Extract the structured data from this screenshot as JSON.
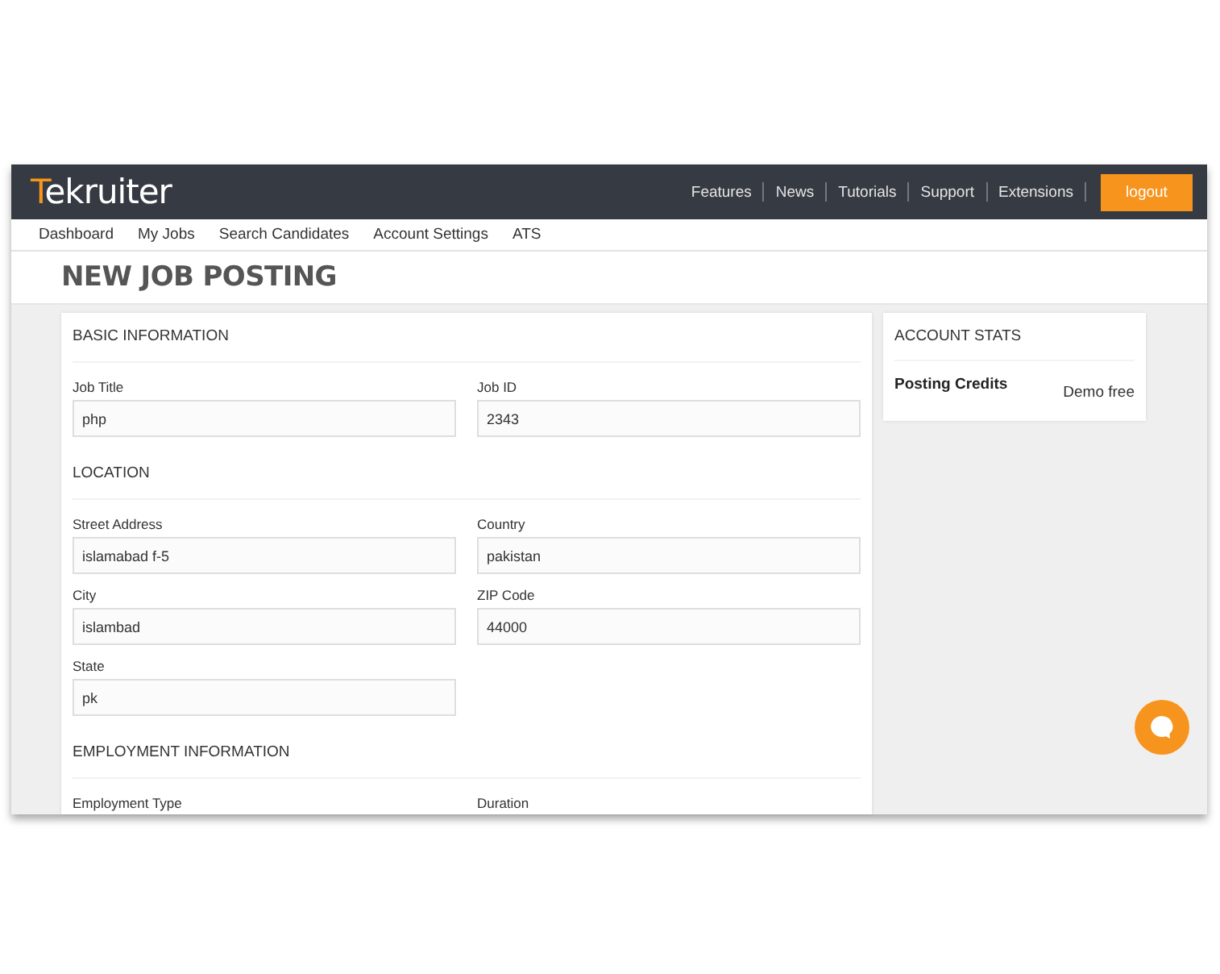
{
  "header": {
    "logo": {
      "mark": "T",
      "rest": "ekruiter"
    },
    "links": [
      "Features",
      "News",
      "Tutorials",
      "Support",
      "Extensions"
    ],
    "logout_button": "logout"
  },
  "nav": [
    "Dashboard",
    "My Jobs",
    "Search Candidates",
    "Account Settings",
    "ATS"
  ],
  "page_title": "NEW JOB POSTING",
  "form": {
    "sections": [
      {
        "heading": "BASIC INFORMATION",
        "fields": [
          {
            "label": "Job Title",
            "value": "php"
          },
          {
            "label": "Job ID",
            "value": "2343"
          }
        ]
      },
      {
        "heading": "LOCATION",
        "fields": [
          {
            "label": "Street Address",
            "value": "islamabad f-5"
          },
          {
            "label": "Country",
            "value": "pakistan"
          },
          {
            "label": "City",
            "value": "islambad"
          },
          {
            "label": "ZIP Code",
            "value": "44000"
          },
          {
            "label": "State",
            "value": "pk"
          }
        ]
      },
      {
        "heading": "EMPLOYMENT INFORMATION",
        "fields": [
          {
            "label": "Employment Type"
          },
          {
            "label": "Duration"
          }
        ]
      }
    ]
  },
  "account_stats": {
    "heading": "ACCOUNT STATS",
    "rows": [
      {
        "label": "Posting Credits",
        "value": "Demo free"
      }
    ]
  }
}
